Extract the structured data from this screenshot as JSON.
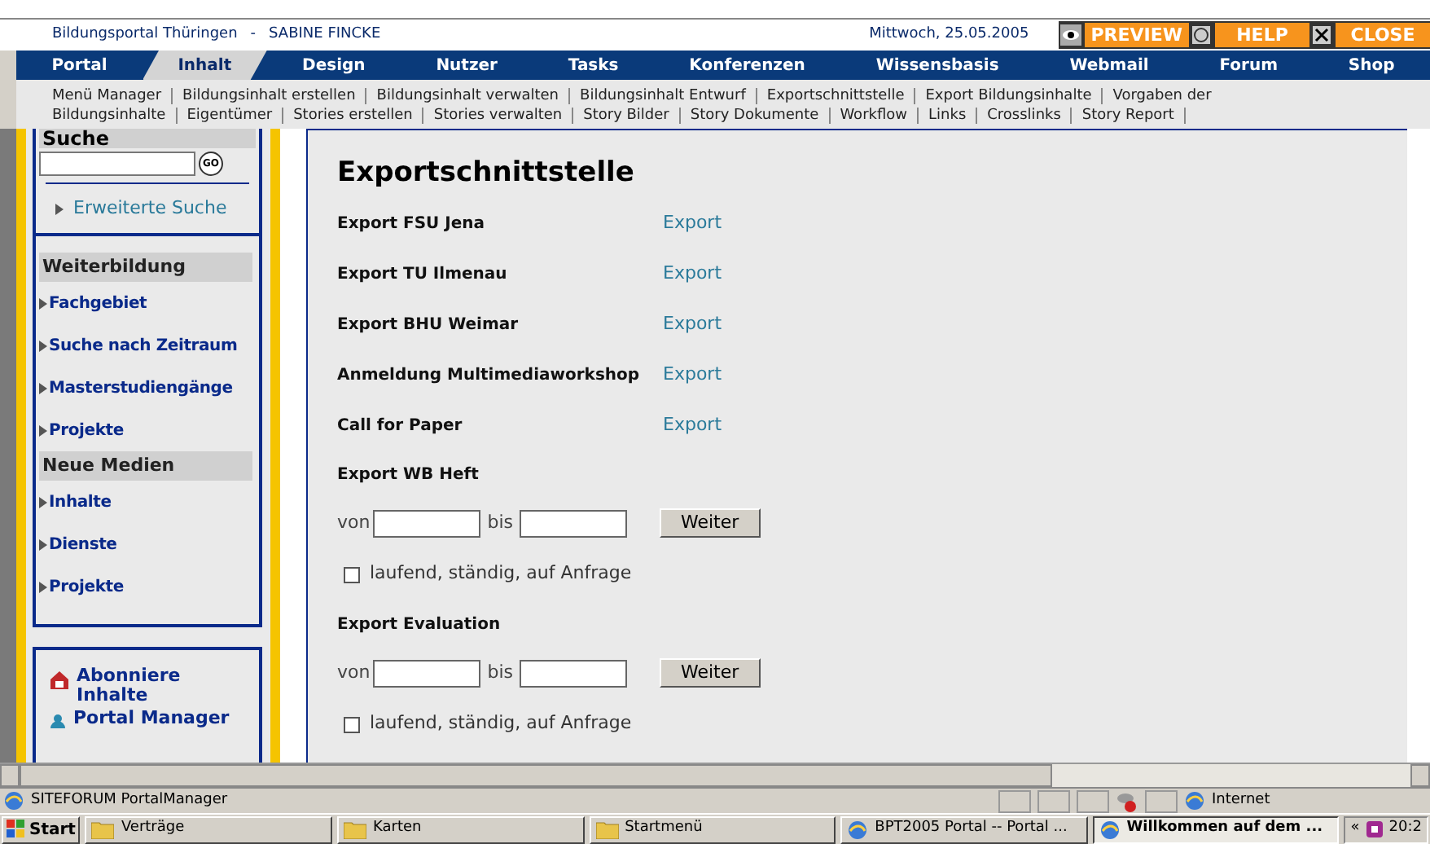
{
  "header": {
    "site": "Bildungsportal Thüringen",
    "separator": "-",
    "user": "SABINE FINCKE",
    "date": "Mittwoch, 25.05.2005",
    "actions": [
      {
        "label": "PREVIEW",
        "kind": "preview"
      },
      {
        "label": "HELP",
        "kind": "help"
      },
      {
        "label": "CLOSE",
        "kind": "close"
      }
    ]
  },
  "nav": [
    {
      "label": "Portal",
      "selected": false
    },
    {
      "label": "Inhalt",
      "selected": true
    },
    {
      "label": "Design",
      "selected": false
    },
    {
      "label": "Nutzer",
      "selected": false
    },
    {
      "label": "Tasks",
      "selected": false
    },
    {
      "label": "Konferenzen",
      "selected": false
    },
    {
      "label": "Wissensbasis",
      "selected": false
    },
    {
      "label": "Webmail",
      "selected": false
    },
    {
      "label": "Forum",
      "selected": false
    },
    {
      "label": "Shop",
      "selected": false
    }
  ],
  "subnav": [
    [
      "Menü Manager",
      "Bildungsinhalt erstellen",
      "Bildungsinhalt verwalten",
      "Bildungsinhalt Entwurf",
      "Exportschnittstelle",
      "Export Bildungsinhalte",
      "Vorgaben der"
    ],
    [
      "Bildungsinhalte",
      "Eigentümer",
      "Stories erstellen",
      "Stories verwalten",
      "Story Bilder",
      "Story Dokumente",
      "Workflow",
      "Links",
      "Crosslinks",
      "Story Report"
    ]
  ],
  "sidebar": {
    "search_label": "Suche",
    "go": "GO",
    "advanced": "Erweiterte Suche",
    "sections": [
      {
        "title": "Weiterbildung",
        "items": [
          "Fachgebiet",
          "Suche nach Zeitraum",
          "Masterstudiengänge",
          "Projekte"
        ]
      },
      {
        "title": "Neue Medien",
        "items": [
          "Inhalte",
          "Dienste",
          "Projekte"
        ]
      }
    ],
    "extras": [
      {
        "label": "Abonniere Inhalte",
        "kind": "subscribe"
      },
      {
        "label": "Portal Manager",
        "kind": "manager"
      }
    ]
  },
  "content": {
    "title": "Exportschnittstelle",
    "exports": [
      {
        "label": "Export FSU Jena",
        "link": "Export"
      },
      {
        "label": "Export TU Ilmenau",
        "link": "Export"
      },
      {
        "label": "Export BHU Weimar",
        "link": "Export"
      },
      {
        "label": "Anmeldung Multimediaworkshop",
        "link": "Export"
      },
      {
        "label": "Call for Paper",
        "link": "Export"
      }
    ],
    "forms": [
      {
        "title": "Export WB Heft",
        "from": "von",
        "to": "bis",
        "button": "Weiter",
        "checkbox": {
          "label": "laufend, ständig, auf Anfrage",
          "checked": false
        }
      },
      {
        "title": "Export Evaluation",
        "from": "von",
        "to": "bis",
        "button": "Weiter",
        "checkbox": {
          "label": "laufend, ständig, auf Anfrage",
          "checked": false
        }
      }
    ]
  },
  "status_bar": {
    "text": "SITEFORUM PortalManager",
    "zone": "Internet"
  },
  "taskbar": {
    "start": "Start",
    "items": [
      {
        "label": "Verträge",
        "kind": "folder",
        "selected": false
      },
      {
        "label": "Karten",
        "kind": "folder",
        "selected": false
      },
      {
        "label": "Startmenü",
        "kind": "folder",
        "selected": false
      },
      {
        "label": "BPT2005 Portal -- Portal ...",
        "kind": "browser",
        "selected": false
      },
      {
        "label": "Willkommen auf dem ...",
        "kind": "browser",
        "selected": true
      }
    ],
    "chevron": "«",
    "clock": "20:2"
  }
}
